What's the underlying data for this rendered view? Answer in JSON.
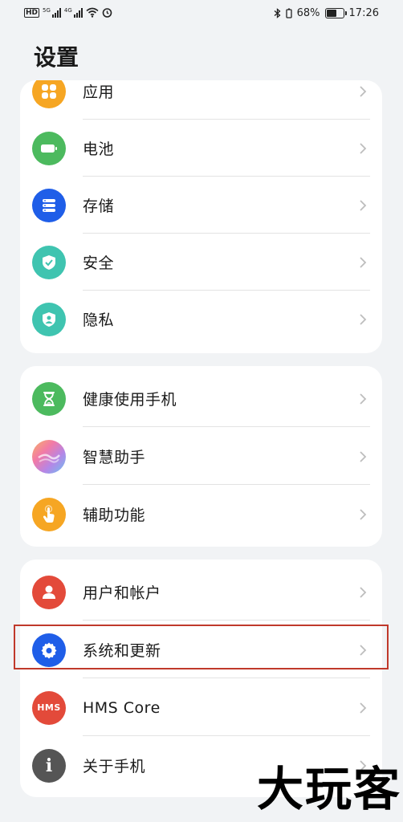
{
  "status_bar": {
    "left_chips": [
      "HD",
      "HD"
    ],
    "net1": "5G",
    "net2": "4G",
    "battery_percent": "68%",
    "battery_level": 0.68,
    "time": "17:26"
  },
  "title": "设置",
  "groups": [
    {
      "items": [
        {
          "label": "应用",
          "icon": "apps-icon",
          "color": "#f6a623"
        },
        {
          "label": "电池",
          "icon": "battery-icon",
          "color": "#4cba5e"
        },
        {
          "label": "存储",
          "icon": "storage-icon",
          "color": "#1f5ee8"
        },
        {
          "label": "安全",
          "icon": "shield-check-icon",
          "color": "#3fc4b0"
        },
        {
          "label": "隐私",
          "icon": "privacy-shield-icon",
          "color": "#3fc4b0"
        }
      ]
    },
    {
      "items": [
        {
          "label": "健康使用手机",
          "icon": "hourglass-icon",
          "color": "#4cba5e"
        },
        {
          "label": "智慧助手",
          "icon": "assistant-orb-icon",
          "color": "#d889c8"
        },
        {
          "label": "辅助功能",
          "icon": "hand-tap-icon",
          "color": "#f6a623"
        }
      ]
    },
    {
      "items": [
        {
          "label": "用户和帐户",
          "icon": "user-icon",
          "color": "#e34a3a"
        },
        {
          "label": "系统和更新",
          "icon": "gear-icon",
          "color": "#1f5ee8"
        },
        {
          "label": "HMS Core",
          "icon": "hms-icon",
          "color": "#e34a3a",
          "icon_text": "HMS"
        },
        {
          "label": "关于手机",
          "icon": "info-icon",
          "color": "#555555",
          "icon_text": "i"
        }
      ]
    }
  ],
  "watermark": "大玩客"
}
